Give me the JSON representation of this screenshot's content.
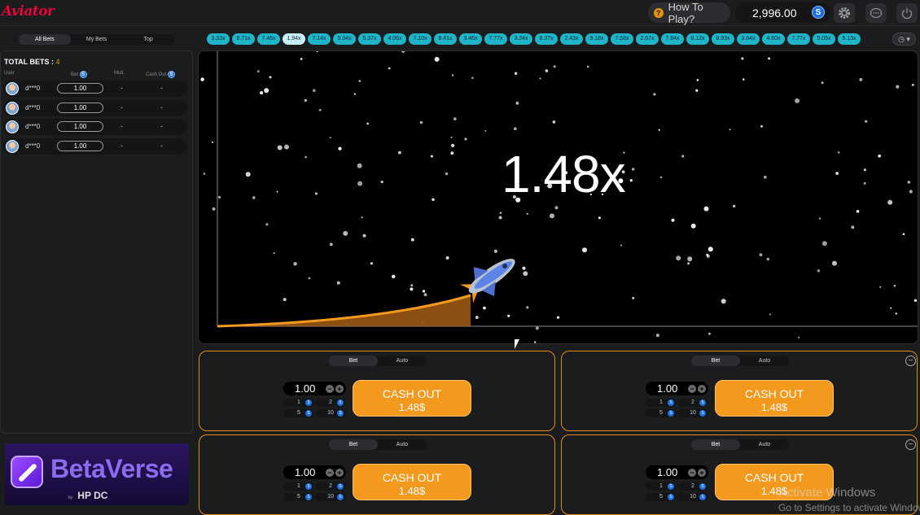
{
  "header": {
    "logo": "Aviator",
    "how_to_play": "How To Play?",
    "balance": "2,996.00",
    "currency_symbol": "S"
  },
  "history": {
    "multipliers": [
      "3.33x",
      "8.71x",
      "7.46x",
      "1.94x",
      "7.14x",
      "5.34x",
      "5.37x",
      "4.06x",
      "7.10x",
      "8.41x",
      "3.46x",
      "7.77x",
      "3.34x",
      "8.37x",
      "2.43x",
      "9.18x",
      "7.58x",
      "2.67x",
      "7.84x",
      "8.12x",
      "8.93x",
      "3.64x",
      "4.60x",
      "7.77x",
      "5.05x",
      "5.13x"
    ],
    "selected_index": 3
  },
  "bets_panel": {
    "tabs": [
      "All Bets",
      "My Bets",
      "Top"
    ],
    "active_tab": 0,
    "total_bets_label": "TOTAL BETS :",
    "total_bets_count": "4",
    "columns": {
      "user": "User",
      "bet": "Bet",
      "mult": "Mult.",
      "cashout": "Cash Out"
    },
    "rows": [
      {
        "user": "d***0",
        "bet": "1.00",
        "mult": "-",
        "cashout": "-"
      },
      {
        "user": "d***0",
        "bet": "1.00",
        "mult": "-",
        "cashout": "-"
      },
      {
        "user": "d***0",
        "bet": "1.00",
        "mult": "-",
        "cashout": "-"
      },
      {
        "user": "d***0",
        "bet": "1.00",
        "mult": "-",
        "cashout": "-"
      }
    ]
  },
  "ad": {
    "title": "BetaVerse",
    "by": "by",
    "brand": "HP DC"
  },
  "game": {
    "multiplier": "1.48x"
  },
  "bet_panels": [
    {
      "tabs": [
        "Bet",
        "Auto"
      ],
      "stake": "1.00",
      "quick": [
        "1",
        "2",
        "5",
        "10"
      ],
      "cashout_label": "CASH OUT",
      "cashout_amount": "1.48$"
    },
    {
      "tabs": [
        "Bet",
        "Auto"
      ],
      "stake": "1.00",
      "quick": [
        "1",
        "2",
        "5",
        "10"
      ],
      "cashout_label": "CASH OUT",
      "cashout_amount": "1.48$"
    },
    {
      "tabs": [
        "Bet",
        "Auto"
      ],
      "stake": "1.00",
      "quick": [
        "1",
        "2",
        "5",
        "10"
      ],
      "cashout_label": "CASH OUT",
      "cashout_amount": "1.48$"
    },
    {
      "tabs": [
        "Bet",
        "Auto"
      ],
      "stake": "1.00",
      "quick": [
        "1",
        "2",
        "5",
        "10"
      ],
      "cashout_label": "CASH OUT",
      "cashout_amount": "1.48$"
    }
  ],
  "watermark": {
    "line1": "Activate Windows",
    "line2": "Go to Settings to activate Windows."
  },
  "colors": {
    "brand_red": "#e50539",
    "accent_orange": "#f39a1e",
    "history_teal": "#1fb4c8"
  }
}
